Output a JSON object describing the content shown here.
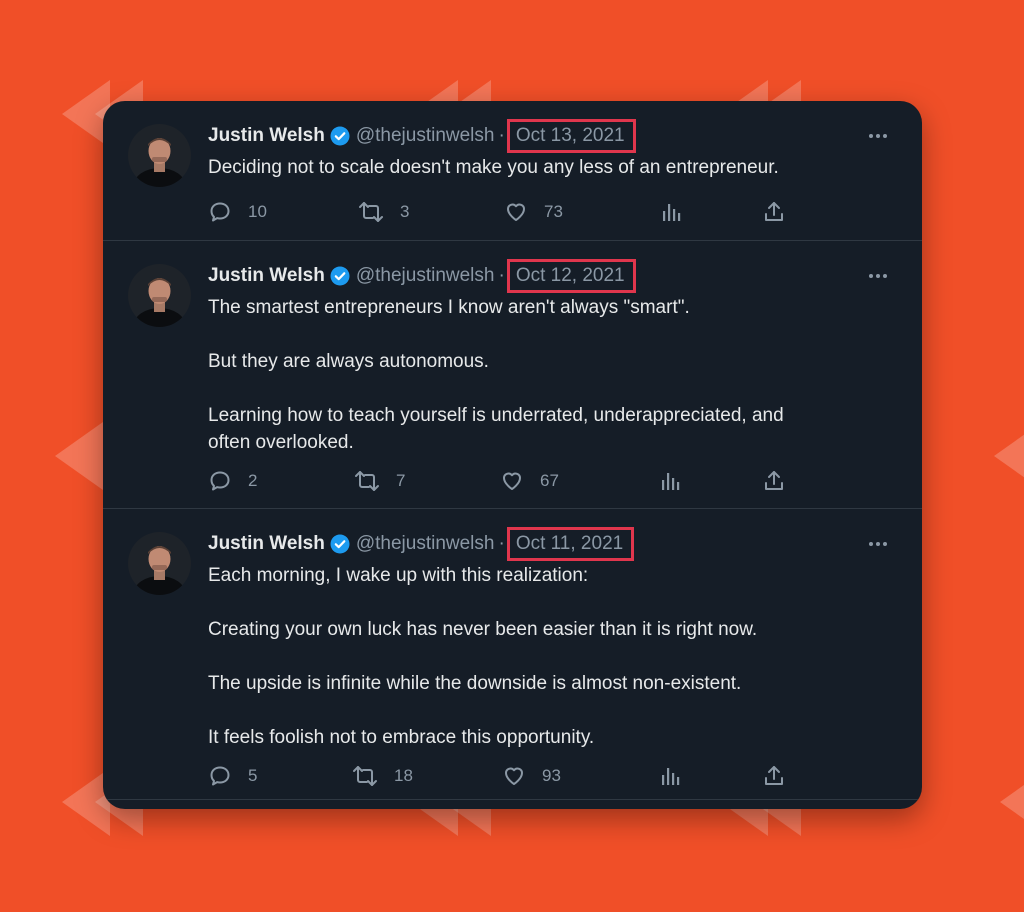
{
  "tweets": [
    {
      "author": "Justin Welsh",
      "handle": "@thejustinwelsh",
      "separator": "·",
      "date": "Oct 13, 2021",
      "lines": [
        "Deciding not to scale doesn't make you any less of an entrepreneur."
      ],
      "replies": "10",
      "retweets": "3",
      "likes": "73"
    },
    {
      "author": "Justin Welsh",
      "handle": "@thejustinwelsh",
      "separator": "·",
      "date": "Oct 12, 2021",
      "lines": [
        "The smartest entrepreneurs I know aren't always \"smart\".",
        "",
        "But they are always autonomous.",
        "",
        "Learning how to teach yourself is underrated, underappreciated, and",
        "often overlooked."
      ],
      "replies": "2",
      "retweets": "7",
      "likes": "67"
    },
    {
      "author": "Justin Welsh",
      "handle": "@thejustinwelsh",
      "separator": "·",
      "date": "Oct 11, 2021",
      "lines": [
        "Each morning, I wake up with this realization:",
        "",
        "Creating your own luck has never been easier than it is right now.",
        "",
        "The upside is infinite while the downside is almost non-existent.",
        "",
        "It feels foolish not to embrace this opportunity."
      ],
      "replies": "5",
      "retweets": "18",
      "likes": "93"
    }
  ],
  "icons": {
    "verified": "verified-badge-icon",
    "more": "more-options-icon",
    "reply": "reply-icon",
    "retweet": "retweet-icon",
    "like": "heart-icon",
    "views": "views-chart-icon",
    "share": "share-icon"
  },
  "colors": {
    "background": "#f04f28",
    "card": "#151d27",
    "text": "#e7e9ea",
    "muted": "#8b98a5",
    "verified": "#1d9bf0",
    "highlight": "#e0364d"
  }
}
